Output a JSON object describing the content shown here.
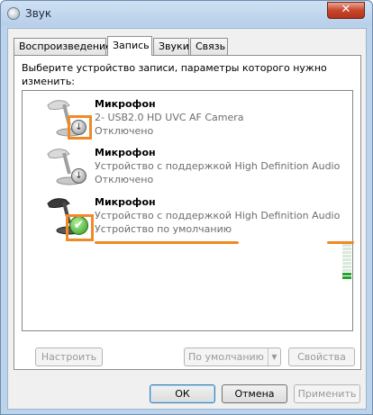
{
  "window": {
    "title": "Звук",
    "close_glyph": "✕"
  },
  "tabs": [
    {
      "label": "Воспроизведение",
      "active": false
    },
    {
      "label": "Запись",
      "active": true
    },
    {
      "label": "Звуки",
      "active": false
    },
    {
      "label": "Связь",
      "active": false
    }
  ],
  "instructions": "Выберите устройство записи, параметры которого нужно изменить:",
  "devices": [
    {
      "name": "Микрофон",
      "description": "2- USB2.0 HD UVC AF Camera",
      "state": "Отключено",
      "icon": "microphone-icon",
      "badge": "disabled-badge-icon",
      "badge_glyph": "↓"
    },
    {
      "name": "Микрофон",
      "description": "Устройство с поддержкой High Definition Audio",
      "state": "Отключено",
      "icon": "microphone-icon",
      "badge": "disabled-badge-icon",
      "badge_glyph": "↓"
    },
    {
      "name": "Микрофон",
      "description": "Устройство с поддержкой High Definition Audio",
      "state": "Устройство по умолчанию",
      "icon": "microphone-icon",
      "badge": "default-check-icon",
      "badge_glyph": "✔",
      "level_meter": 0.15
    }
  ],
  "buttons": {
    "configure": "Настроить",
    "set_default": "По умолчанию",
    "set_default_arrow": "▼",
    "properties": "Свойства",
    "ok": "ОК",
    "cancel": "Отмена",
    "apply": "Применить"
  },
  "colors": {
    "highlight": "#f08a24",
    "level_on": "#25a12f",
    "check_badge": "#2f9a1e"
  }
}
